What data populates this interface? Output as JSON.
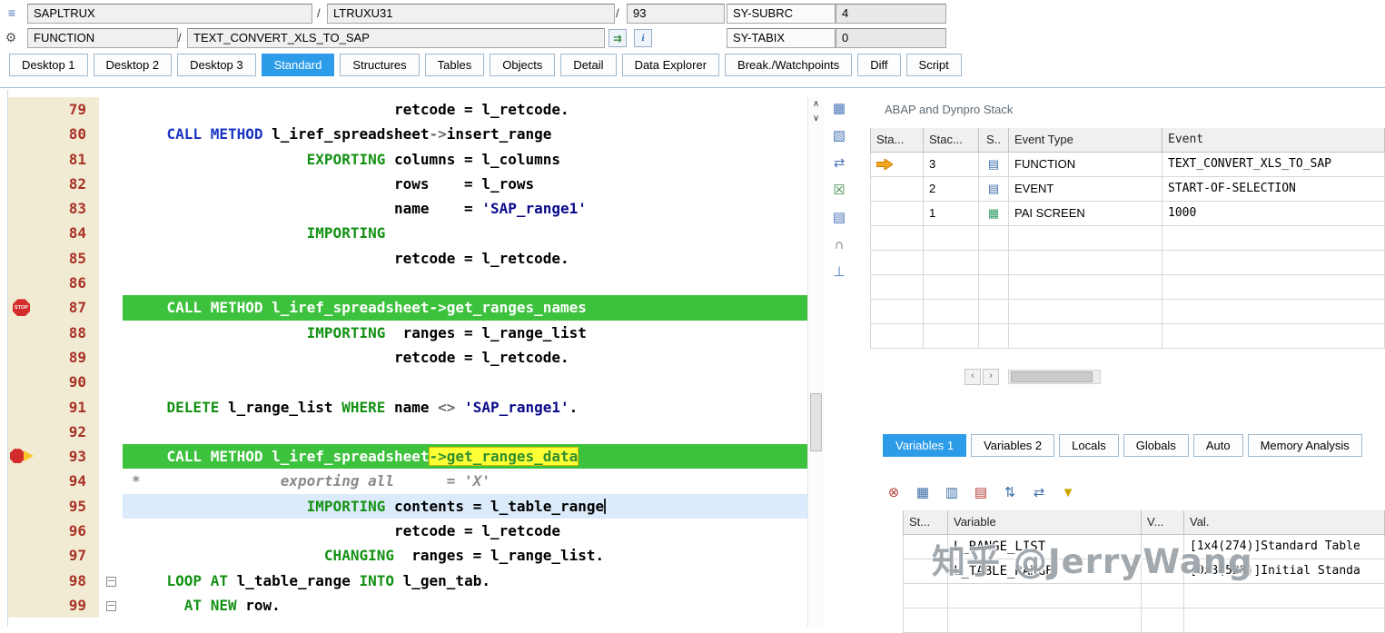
{
  "header": {
    "row1": {
      "program": "SAPLTRUX",
      "sep1": "/",
      "include": "LTRUXU31",
      "sep2": "/",
      "line_no": "93",
      "sy_subrc_label": "SY-SUBRC",
      "sy_subrc_value": "4"
    },
    "row2": {
      "obj_type": "FUNCTION",
      "sep": "/",
      "obj_name": "TEXT_CONVERT_XLS_TO_SAP",
      "sy_tabix_label": "SY-TABIX",
      "sy_tabix_value": "0"
    }
  },
  "tabs": [
    {
      "label": "Desktop 1",
      "active": false
    },
    {
      "label": "Desktop 2",
      "active": false
    },
    {
      "label": "Desktop 3",
      "active": false
    },
    {
      "label": "Standard",
      "active": true
    },
    {
      "label": "Structures",
      "active": false
    },
    {
      "label": "Tables",
      "active": false
    },
    {
      "label": "Objects",
      "active": false
    },
    {
      "label": "Detail",
      "active": false
    },
    {
      "label": "Data Explorer",
      "active": false
    },
    {
      "label": "Break./Watchpoints",
      "active": false
    },
    {
      "label": "Diff",
      "active": false
    },
    {
      "label": "Script",
      "active": false
    }
  ],
  "editor": {
    "lines": [
      {
        "n": "79",
        "hl": "",
        "tokens": [
          [
            "pln",
            "                              retcode = l_retcode."
          ]
        ]
      },
      {
        "n": "80",
        "hl": "",
        "tokens": [
          [
            "pln",
            "    "
          ],
          [
            "kw",
            "CALL METHOD"
          ],
          [
            "pln",
            " l_iref_spreadsheet"
          ],
          [
            "op",
            "->"
          ],
          [
            "pln",
            "insert_range"
          ]
        ]
      },
      {
        "n": "81",
        "hl": "",
        "tokens": [
          [
            "pln",
            "                    "
          ],
          [
            "kwg",
            "EXPORTING"
          ],
          [
            "pln",
            " columns = l_columns"
          ]
        ]
      },
      {
        "n": "82",
        "hl": "",
        "tokens": [
          [
            "pln",
            "                              rows    = l_rows"
          ]
        ]
      },
      {
        "n": "83",
        "hl": "",
        "tokens": [
          [
            "pln",
            "                              name    = "
          ],
          [
            "str",
            "'SAP_range1'"
          ]
        ]
      },
      {
        "n": "84",
        "hl": "",
        "tokens": [
          [
            "pln",
            "                    "
          ],
          [
            "kwg",
            "IMPORTING"
          ]
        ]
      },
      {
        "n": "85",
        "hl": "",
        "tokens": [
          [
            "pln",
            "                              retcode = l_retcode."
          ]
        ]
      },
      {
        "n": "86",
        "hl": "",
        "tokens": []
      },
      {
        "n": "87",
        "hl": "green",
        "margin": "stop",
        "tokens": [
          [
            "pln",
            "    "
          ],
          [
            "kw",
            "CALL METHOD"
          ],
          [
            "pln",
            " l_iref_spreadsheet"
          ],
          [
            "op",
            "->"
          ],
          [
            "pln",
            "get_ranges_names"
          ]
        ]
      },
      {
        "n": "88",
        "hl": "",
        "tokens": [
          [
            "pln",
            "                    "
          ],
          [
            "kwg",
            "IMPORTING"
          ],
          [
            "pln",
            "  ranges = l_range_list"
          ]
        ]
      },
      {
        "n": "89",
        "hl": "",
        "tokens": [
          [
            "pln",
            "                              retcode = l_retcode."
          ]
        ]
      },
      {
        "n": "90",
        "hl": "",
        "tokens": []
      },
      {
        "n": "91",
        "hl": "",
        "tokens": [
          [
            "pln",
            "    "
          ],
          [
            "kwg",
            "DELETE"
          ],
          [
            "pln",
            " l_range_list "
          ],
          [
            "kwg",
            "WHERE"
          ],
          [
            "pln",
            " name "
          ],
          [
            "op",
            "<>"
          ],
          [
            "pln",
            " "
          ],
          [
            "str",
            "'SAP_range1'"
          ],
          [
            "pln",
            "."
          ]
        ]
      },
      {
        "n": "92",
        "hl": "",
        "tokens": []
      },
      {
        "n": "93",
        "hl": "green",
        "margin": "current",
        "tokens": [
          [
            "pln",
            "    "
          ],
          [
            "kw",
            "CALL METHOD"
          ],
          [
            "pln",
            " l_iref_spreadsheet"
          ],
          [
            "ylw",
            "->get_ranges_data"
          ]
        ]
      },
      {
        "n": "94",
        "hl": "",
        "tokens": [
          [
            "cm",
            "*                exporting all      = 'X'"
          ]
        ]
      },
      {
        "n": "95",
        "hl": "cursorline",
        "tokens": [
          [
            "pln",
            "                    "
          ],
          [
            "kwg",
            "IMPORTING"
          ],
          [
            "pln",
            " contents = l_table_range"
          ],
          [
            "cur",
            ""
          ]
        ]
      },
      {
        "n": "96",
        "hl": "",
        "tokens": [
          [
            "pln",
            "                              retcode = l_retcode"
          ]
        ]
      },
      {
        "n": "97",
        "hl": "",
        "tokens": [
          [
            "pln",
            "                      "
          ],
          [
            "kwg",
            "CHANGING"
          ],
          [
            "pln",
            "  ranges = l_range_list."
          ]
        ]
      },
      {
        "n": "98",
        "hl": "",
        "fold": true,
        "tokens": [
          [
            "pln",
            "    "
          ],
          [
            "kwg",
            "LOOP AT"
          ],
          [
            "pln",
            " l_table_range "
          ],
          [
            "kwg",
            "INTO"
          ],
          [
            "pln",
            " l_gen_tab."
          ]
        ]
      },
      {
        "n": "99",
        "hl": "",
        "fold": true,
        "tokens": [
          [
            "pln",
            "      "
          ],
          [
            "kwg",
            "AT NEW"
          ],
          [
            "pln",
            " row."
          ]
        ]
      }
    ],
    "side_icons": [
      {
        "name": "table-calculate-icon",
        "glyph": "▦",
        "color": "#4a76b8"
      },
      {
        "name": "create-entry-icon",
        "glyph": "▧",
        "color": "#4a76b8"
      },
      {
        "name": "swap-icon",
        "glyph": "⇄",
        "color": "#4a76b8"
      },
      {
        "name": "spreadsheet-icon",
        "glyph": "☒",
        "color": "#3e8e4e"
      },
      {
        "name": "rows-icon",
        "glyph": "▤",
        "color": "#4a76b8"
      },
      {
        "name": "headset-icon",
        "glyph": "∩",
        "color": "#555555"
      },
      {
        "name": "hierarchy-icon",
        "glyph": "⊥",
        "color": "#4a76b8"
      }
    ]
  },
  "stack": {
    "title": "ABAP and Dynpro Stack",
    "columns": [
      "Sta...",
      "Stac...",
      "S..",
      "Event Type",
      "Event"
    ],
    "rows": [
      {
        "active": true,
        "level": "3",
        "icon": "function-icon",
        "event_type": "FUNCTION",
        "event": "TEXT_CONVERT_XLS_TO_SAP"
      },
      {
        "active": false,
        "level": "2",
        "icon": "event-icon",
        "event_type": "EVENT",
        "event": "START-OF-SELECTION"
      },
      {
        "active": false,
        "level": "1",
        "icon": "screen-icon",
        "event_type": "PAI SCREEN",
        "event": "1000"
      }
    ],
    "empty_rows": 5
  },
  "variables": {
    "tabs": [
      {
        "label": "Variables 1",
        "active": true
      },
      {
        "label": "Variables 2",
        "active": false
      },
      {
        "label": "Locals",
        "active": false
      },
      {
        "label": "Globals",
        "active": false
      },
      {
        "label": "Auto",
        "active": false
      },
      {
        "label": "Memory Analysis",
        "active": false
      }
    ],
    "toolbar": [
      {
        "name": "delete-variables-icon",
        "glyph": "⊗",
        "color": "#b43c3c"
      },
      {
        "name": "table-settings-icon",
        "glyph": "▦",
        "color": "#3a6ea8"
      },
      {
        "name": "table-copy-icon",
        "glyph": "▥",
        "color": "#3a6ea8"
      },
      {
        "name": "table-remove-icon",
        "glyph": "▤",
        "color": "#b43c3c"
      },
      {
        "name": "column-split-icon",
        "glyph": "⇅",
        "color": "#3a6ea8"
      },
      {
        "name": "sort-icon",
        "glyph": "⇄",
        "color": "#3a6ea8"
      },
      {
        "name": "filter-icon",
        "glyph": "▼",
        "color": "#c8a400"
      }
    ],
    "columns": [
      "St...",
      "Variable",
      "V...",
      "Val."
    ],
    "rows": [
      {
        "variable": "L_RANGE_LIST",
        "value": "[1x4(274)]Standard Table"
      },
      {
        "variable": "L_TABLE_RANGE",
        "value": "[0x3(528)]Initial Standa"
      }
    ],
    "empty_rows": 2
  },
  "watermark": "知乎 @JerryWang",
  "icons": {
    "stop_label": "STOP",
    "function-icon": {
      "glyph": "▤",
      "color": "#3f6fae"
    },
    "event-icon": {
      "glyph": "▤",
      "color": "#3f6fae"
    },
    "screen-icon": {
      "glyph": "▦",
      "color": "#2f9e62"
    },
    "doc_icon": "≡",
    "gear_icon": "⚙",
    "transfer_icon": "⇉",
    "info_icon": "i",
    "scroll_up": "∧",
    "scroll_down": "∨",
    "scroll_left": "‹",
    "scroll_right": "›"
  }
}
